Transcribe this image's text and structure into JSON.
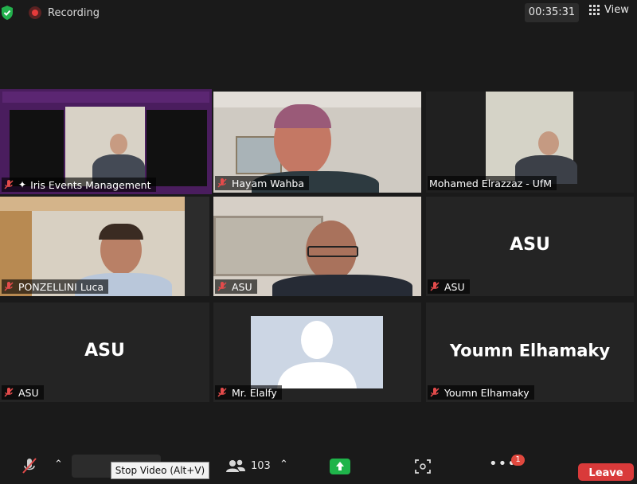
{
  "topbar": {
    "recording_label": "Recording",
    "timer": "00:35:31",
    "view_label": "View"
  },
  "participants": [
    {
      "name": "Iris Events Management",
      "type": "video"
    },
    {
      "name": "Hayam Wahba",
      "type": "video"
    },
    {
      "name": "Mohamed Elrazzaz - UfM",
      "type": "video"
    },
    {
      "name": "PONZELLINI Luca",
      "type": "video"
    },
    {
      "name": "ASU",
      "type": "video"
    },
    {
      "name": "ASU",
      "type": "no-video",
      "display_text": "ASU"
    },
    {
      "name": "ASU",
      "type": "no-video",
      "display_text": "ASU"
    },
    {
      "name": "Mr. Elalfy",
      "type": "avatar"
    },
    {
      "name": "Youmn Elhamaky",
      "type": "no-video",
      "display_text": "Youmn Elhamaky"
    }
  ],
  "toolbar": {
    "participant_count": "103",
    "tooltip": "Stop Video (Alt+V)",
    "more_badge": "1",
    "leave_label": "Leave"
  },
  "colors": {
    "active_speaker": "#cfe86a",
    "leave": "#d93a3a",
    "share": "#1fb44a",
    "recording": "#e53b3b"
  }
}
